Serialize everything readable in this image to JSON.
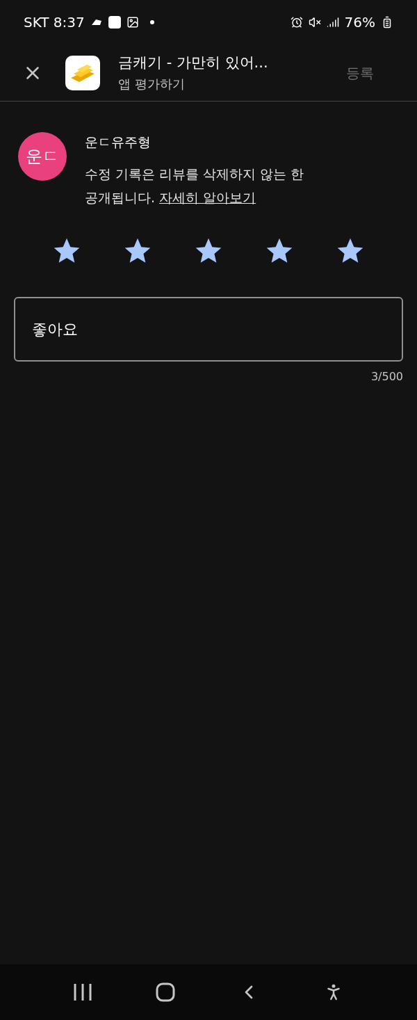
{
  "status_bar": {
    "carrier_time": "SKT 8:37",
    "battery": "76%"
  },
  "header": {
    "app_title": "금캐기 - 가만히 있어...",
    "subtitle": "앱 평가하기",
    "submit": {
      "label": "등록",
      "disabled": true
    }
  },
  "author": {
    "initials": "운ㄷ",
    "name": "운ㄷ유주형",
    "notice": "수정 기록은 리뷰를 삭제하지 않는 한 공개됩니다.",
    "link": "자세히 알아보기"
  },
  "rating": {
    "stars": 5
  },
  "review": {
    "value": "좋아요",
    "counter": "3/500"
  }
}
